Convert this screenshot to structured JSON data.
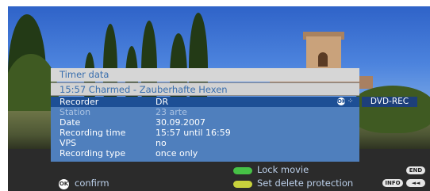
{
  "panel": {
    "title": "Timer data",
    "subtitle": "15:57 Charmed - Zauberhafte Hexen",
    "rows": [
      {
        "label": "Recorder",
        "value": "DR"
      },
      {
        "label": "Station",
        "value": "23 arte"
      },
      {
        "label": "Date",
        "value": "30.09.2007"
      },
      {
        "label": "Recording time",
        "value": "15:57 until 16:59"
      },
      {
        "label": "VPS",
        "value": "no"
      },
      {
        "label": "Recording type",
        "value": "once only"
      }
    ],
    "recorder_option": "DVD-REC"
  },
  "footer": {
    "confirm_label": "confirm",
    "lock_label": "Lock movie",
    "protect_label": "Set delete protection",
    "end_label": "END",
    "info_label": "INFO",
    "back_label": "◄◄",
    "ok_label": "OK",
    "nav_label": "⁘"
  },
  "colors": {
    "accent": "#1d4f95",
    "green_key": "#46c146",
    "yellow_key": "#c8d23c"
  }
}
